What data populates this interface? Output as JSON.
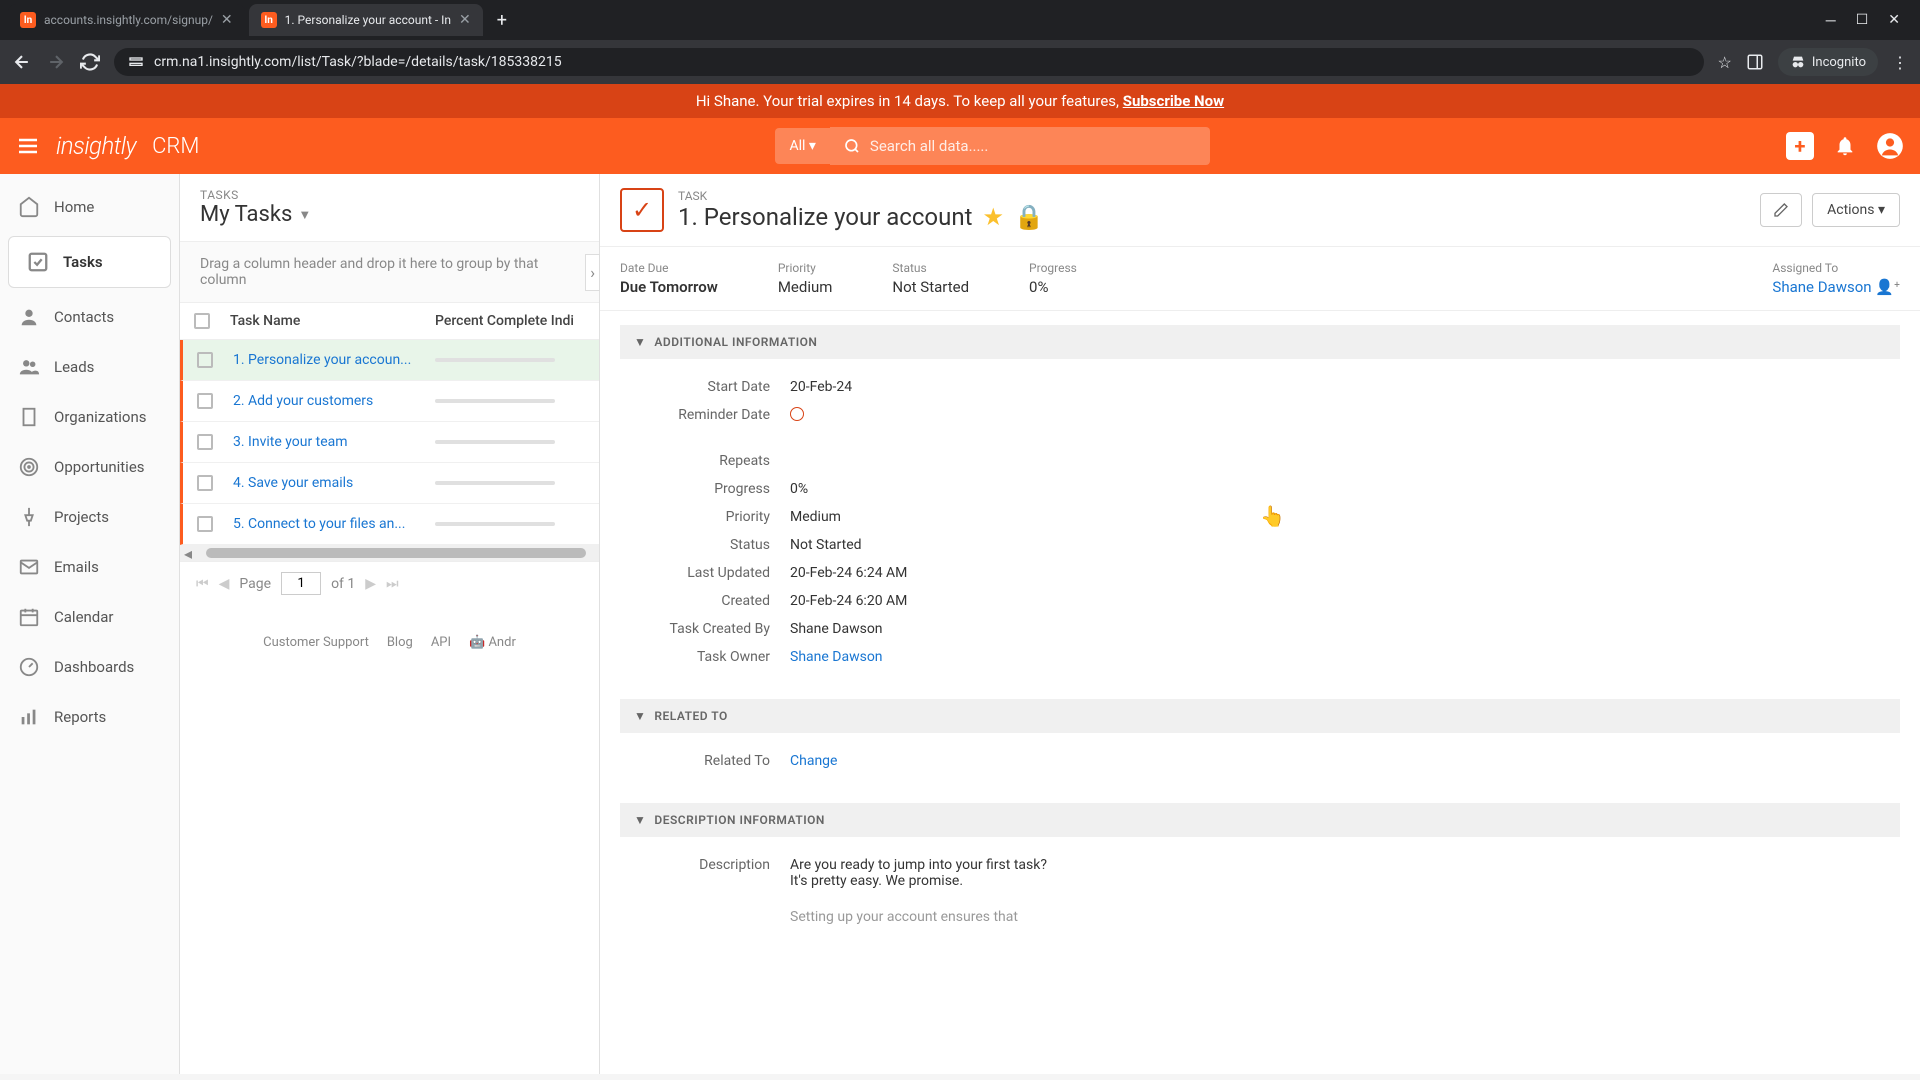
{
  "browser": {
    "tabs": [
      {
        "title": "accounts.insightly.com/signup/",
        "active": false
      },
      {
        "title": "1. Personalize your account - In",
        "active": true
      }
    ],
    "url": "crm.na1.insightly.com/list/Task/?blade=/details/task/185338215",
    "incognito_label": "Incognito"
  },
  "trial_banner": {
    "prefix": "Hi Shane. Your trial expires in 14 days. To keep all your features, ",
    "link": "Subscribe Now"
  },
  "header": {
    "logo": "insightly",
    "app_name": "CRM",
    "search_scope": "All",
    "search_placeholder": "Search all data....."
  },
  "sidebar": {
    "items": [
      {
        "label": "Home",
        "icon": "home"
      },
      {
        "label": "Tasks",
        "icon": "check",
        "active": true
      },
      {
        "label": "Contacts",
        "icon": "person"
      },
      {
        "label": "Leads",
        "icon": "people"
      },
      {
        "label": "Organizations",
        "icon": "building"
      },
      {
        "label": "Opportunities",
        "icon": "target"
      },
      {
        "label": "Projects",
        "icon": "pin"
      },
      {
        "label": "Emails",
        "icon": "mail"
      },
      {
        "label": "Calendar",
        "icon": "calendar"
      },
      {
        "label": "Dashboards",
        "icon": "gauge"
      },
      {
        "label": "Reports",
        "icon": "bars"
      }
    ]
  },
  "list": {
    "label": "TASKS",
    "title": "My Tasks",
    "group_hint": "Drag a column header and drop it here to group by that column",
    "col_name": "Task Name",
    "col_pct": "Percent Complete Indi",
    "rows": [
      {
        "name": "1. Personalize your accoun...",
        "selected": true
      },
      {
        "name": "2. Add your customers"
      },
      {
        "name": "3. Invite your team"
      },
      {
        "name": "4. Save your emails"
      },
      {
        "name": "5. Connect to your files an..."
      }
    ],
    "pager": {
      "page_label": "Page",
      "page": "1",
      "total": "of 1"
    },
    "footer": {
      "support": "Customer Support",
      "blog": "Blog",
      "api": "API",
      "android": "Andr"
    }
  },
  "detail": {
    "label": "TASK",
    "title": "1. Personalize your account",
    "actions_label": "Actions",
    "meta": {
      "date_due_label": "Date Due",
      "date_due": "Due Tomorrow",
      "priority_label": "Priority",
      "priority": "Medium",
      "status_label": "Status",
      "status": "Not Started",
      "progress_label": "Progress",
      "progress": "0%",
      "assigned_label": "Assigned To",
      "assigned": "Shane Dawson"
    },
    "sections": {
      "additional": {
        "title": "ADDITIONAL INFORMATION",
        "start_date_l": "Start Date",
        "start_date": "20-Feb-24",
        "reminder_l": "Reminder Date",
        "repeats_l": "Repeats",
        "repeats": "",
        "progress_l": "Progress",
        "progress": "0%",
        "priority_l": "Priority",
        "priority": "Medium",
        "status_l": "Status",
        "status": "Not Started",
        "updated_l": "Last Updated",
        "updated": "20-Feb-24 6:24 AM",
        "created_l": "Created",
        "created": "20-Feb-24 6:20 AM",
        "creator_l": "Task Created By",
        "creator": "Shane Dawson",
        "owner_l": "Task Owner",
        "owner": "Shane Dawson"
      },
      "related": {
        "title": "RELATED TO",
        "related_l": "Related To",
        "change": "Change"
      },
      "description": {
        "title": "DESCRIPTION INFORMATION",
        "desc_l": "Description",
        "line1": "Are you ready to jump into your first task?",
        "line2": "It's pretty easy. We promise.",
        "line3": "Setting up your account ensures that"
      }
    }
  }
}
